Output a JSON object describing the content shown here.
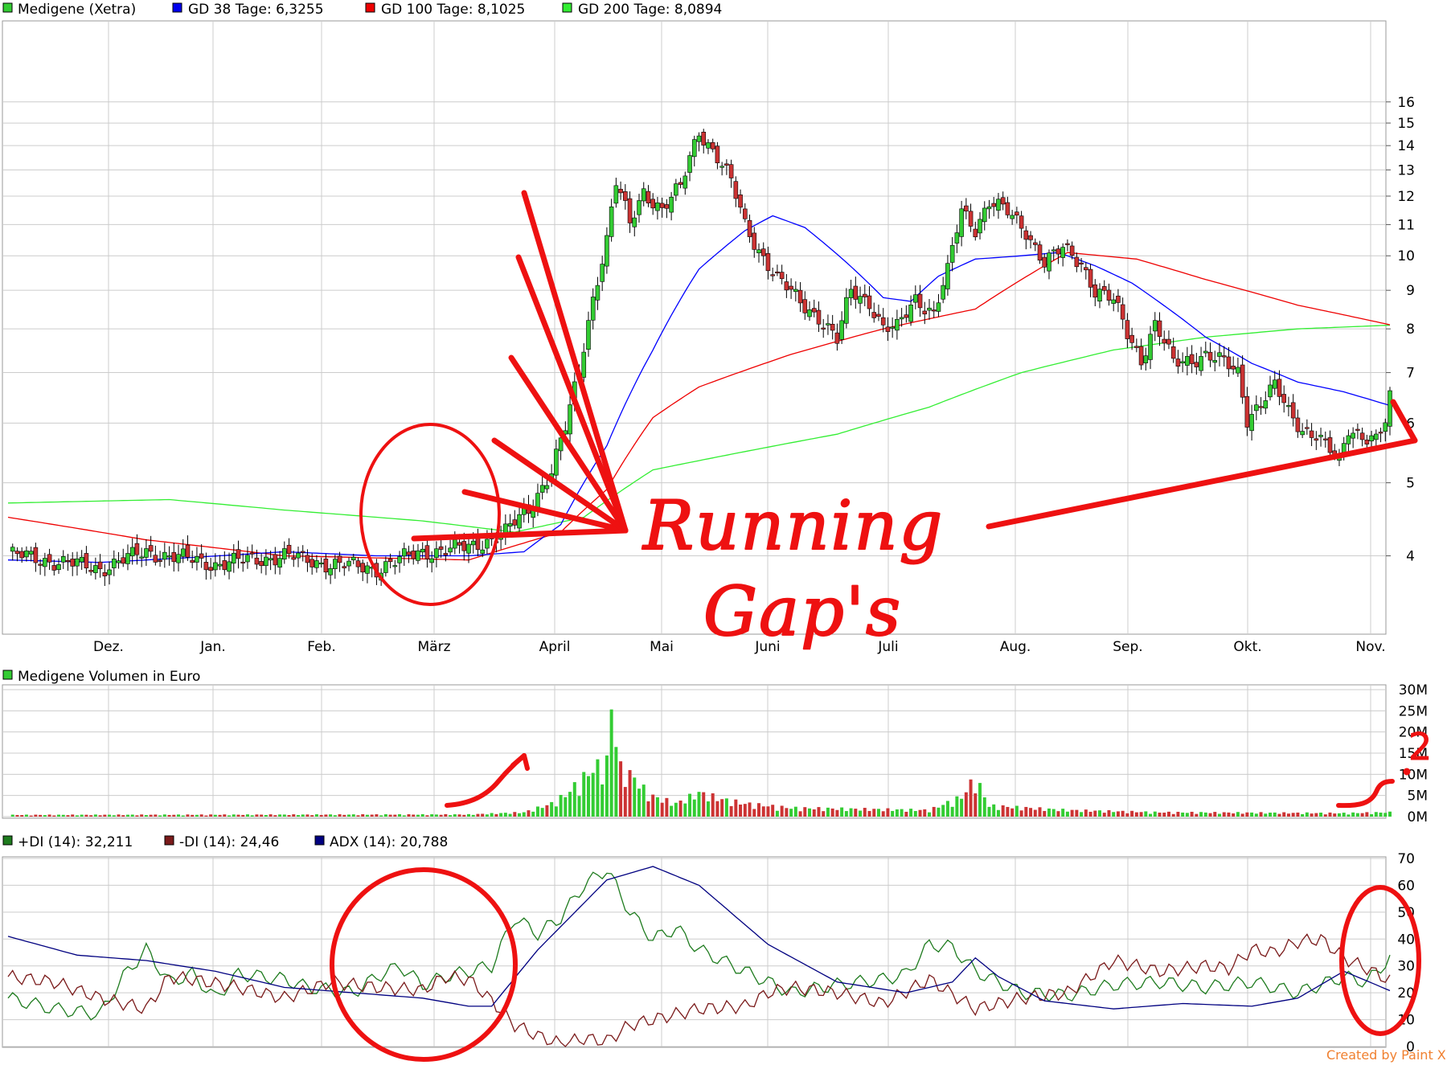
{
  "colors": {
    "up": "#33cc33",
    "down": "#cc3333",
    "gd38": "#0000ff",
    "gd100": "#ee0000",
    "gd200": "#33ee33",
    "pdi": "#1e7b1e",
    "mdi": "#7a1a1a",
    "adx": "#000080",
    "annotation": "#ee1111",
    "grid": "#cccccc"
  },
  "chart_data": [
    {
      "type": "candlestick",
      "log_scale": true,
      "ylim": [
        3.3,
        16.8
      ],
      "y_ticks": [
        "4",
        "5",
        "6",
        "7",
        "8",
        "9",
        "10",
        "11",
        "12",
        "13",
        "14",
        "15",
        "16"
      ],
      "x_ticks": [
        "Dez.",
        "Jan.",
        "Feb.",
        "März",
        "April",
        "Mai",
        "Juni",
        "Juli",
        "Aug.",
        "Sep.",
        "Okt.",
        "Nov."
      ],
      "grid": true,
      "legend": [
        {
          "label": "Medigene (Xetra)",
          "color": "#33cc33"
        },
        {
          "label": "GD 38 Tage: 6,3255",
          "color": "#0000ee"
        },
        {
          "label": "GD 100 Tage: 8,1025",
          "color": "#ee0000"
        },
        {
          "label": "GD 200 Tage: 8,0894",
          "color": "#33ee33"
        }
      ],
      "price_keypoints": [
        [
          0,
          4.02
        ],
        [
          20,
          3.85
        ],
        [
          30,
          4.05
        ],
        [
          45,
          3.9
        ],
        [
          60,
          4.0
        ],
        [
          70,
          3.9
        ],
        [
          80,
          3.85
        ],
        [
          90,
          4.05
        ],
        [
          100,
          4.1
        ],
        [
          108,
          4.3
        ],
        [
          113,
          4.6
        ],
        [
          118,
          5.2
        ],
        [
          121,
          5.9
        ],
        [
          124,
          7.0
        ],
        [
          127,
          8.8
        ],
        [
          130,
          10.5
        ],
        [
          132,
          12.5
        ],
        [
          135,
          11.0
        ],
        [
          138,
          12.2
        ],
        [
          142,
          11.5
        ],
        [
          146,
          12.3
        ],
        [
          150,
          14.7
        ],
        [
          154,
          13.5
        ],
        [
          157,
          12.5
        ],
        [
          160,
          11.0
        ],
        [
          163,
          10.2
        ],
        [
          167,
          9.3
        ],
        [
          172,
          8.7
        ],
        [
          176,
          8.3
        ],
        [
          180,
          7.7
        ],
        [
          183,
          9.0
        ],
        [
          187,
          8.7
        ],
        [
          190,
          8.0
        ],
        [
          193,
          8.0
        ],
        [
          197,
          8.8
        ],
        [
          201,
          8.4
        ],
        [
          204,
          9.5
        ],
        [
          207,
          11.5
        ],
        [
          210,
          10.9
        ],
        [
          213,
          11.8
        ],
        [
          217,
          11.4
        ],
        [
          221,
          10.8
        ],
        [
          225,
          9.8
        ],
        [
          229,
          10.2
        ],
        [
          233,
          9.8
        ],
        [
          236,
          9.0
        ],
        [
          240,
          8.7
        ],
        [
          243,
          7.9
        ],
        [
          246,
          7.3
        ],
        [
          249,
          8.1
        ],
        [
          253,
          7.2
        ],
        [
          257,
          7.3
        ],
        [
          260,
          7.4
        ],
        [
          264,
          7.2
        ],
        [
          267,
          7.0
        ],
        [
          269,
          6.1
        ],
        [
          272,
          6.4
        ],
        [
          275,
          6.7
        ],
        [
          278,
          6.2
        ],
        [
          281,
          5.9
        ],
        [
          284,
          5.8
        ],
        [
          287,
          5.5
        ],
        [
          289,
          5.3
        ],
        [
          291,
          5.9
        ],
        [
          294,
          5.8
        ],
        [
          297,
          5.7
        ],
        [
          299,
          6.0
        ],
        [
          300,
          6.45
        ]
      ],
      "gd38_keypoints": [
        [
          0,
          3.95
        ],
        [
          20,
          3.92
        ],
        [
          40,
          3.98
        ],
        [
          60,
          4.05
        ],
        [
          80,
          4.0
        ],
        [
          100,
          4.0
        ],
        [
          112,
          4.05
        ],
        [
          120,
          4.4
        ],
        [
          130,
          5.6
        ],
        [
          140,
          7.5
        ],
        [
          150,
          9.6
        ],
        [
          160,
          10.8
        ],
        [
          166,
          11.3
        ],
        [
          173,
          10.9
        ],
        [
          182,
          9.8
        ],
        [
          190,
          8.8
        ],
        [
          196,
          8.7
        ],
        [
          202,
          9.4
        ],
        [
          210,
          9.9
        ],
        [
          220,
          10.0
        ],
        [
          228,
          10.1
        ],
        [
          236,
          9.7
        ],
        [
          244,
          9.2
        ],
        [
          252,
          8.5
        ],
        [
          260,
          7.8
        ],
        [
          270,
          7.2
        ],
        [
          280,
          6.8
        ],
        [
          290,
          6.6
        ],
        [
          300,
          6.33
        ]
      ],
      "gd100_keypoints": [
        [
          0,
          4.5
        ],
        [
          30,
          4.2
        ],
        [
          60,
          4.0
        ],
        [
          100,
          3.95
        ],
        [
          120,
          4.3
        ],
        [
          130,
          4.9
        ],
        [
          140,
          6.1
        ],
        [
          150,
          6.7
        ],
        [
          170,
          7.4
        ],
        [
          190,
          8.0
        ],
        [
          210,
          8.5
        ],
        [
          220,
          9.3
        ],
        [
          230,
          10.1
        ],
        [
          245,
          9.9
        ],
        [
          260,
          9.3
        ],
        [
          280,
          8.6
        ],
        [
          300,
          8.1
        ]
      ],
      "gd200_keypoints": [
        [
          0,
          4.7
        ],
        [
          35,
          4.75
        ],
        [
          60,
          4.6
        ],
        [
          90,
          4.45
        ],
        [
          110,
          4.3
        ],
        [
          125,
          4.5
        ],
        [
          140,
          5.2
        ],
        [
          160,
          5.5
        ],
        [
          180,
          5.8
        ],
        [
          200,
          6.3
        ],
        [
          220,
          7.0
        ],
        [
          240,
          7.5
        ],
        [
          260,
          7.8
        ],
        [
          280,
          8.0
        ],
        [
          300,
          8.09
        ]
      ]
    },
    {
      "type": "bar",
      "title": "Medigene Volumen in Euro",
      "ylim": [
        0,
        30
      ],
      "y_ticks": [
        "0M",
        "5M",
        "10M",
        "15M",
        "20M",
        "25M",
        "30M"
      ],
      "grid": true,
      "volume_keypoints": [
        [
          0,
          0.4
        ],
        [
          100,
          0.5
        ],
        [
          112,
          1.0
        ],
        [
          118,
          3.0
        ],
        [
          121,
          5.0
        ],
        [
          124,
          8.0
        ],
        [
          127,
          11.0
        ],
        [
          130,
          12.5
        ],
        [
          131,
          25.5
        ],
        [
          133,
          11.0
        ],
        [
          136,
          9.0
        ],
        [
          139,
          5.0
        ],
        [
          145,
          3.0
        ],
        [
          150,
          5.5
        ],
        [
          155,
          4.0
        ],
        [
          160,
          3.0
        ],
        [
          170,
          2.0
        ],
        [
          200,
          1.5
        ],
        [
          207,
          4.5
        ],
        [
          210,
          9.0
        ],
        [
          213,
          2.5
        ],
        [
          230,
          1.5
        ],
        [
          250,
          1.0
        ],
        [
          290,
          0.8
        ],
        [
          300,
          1.0
        ]
      ]
    },
    {
      "type": "line",
      "ylim": [
        0,
        70
      ],
      "y_ticks": [
        "0",
        "10",
        "20",
        "30",
        "40",
        "50",
        "60",
        "70"
      ],
      "grid": true,
      "series": [
        {
          "name": "+DI (14): 32,211",
          "color": "#1e7b1e",
          "keypoints": [
            [
              0,
              18
            ],
            [
              10,
              14
            ],
            [
              20,
              12
            ],
            [
              25,
              26
            ],
            [
              30,
              36
            ],
            [
              35,
              24
            ],
            [
              40,
              27
            ],
            [
              45,
              18
            ],
            [
              50,
              27
            ],
            [
              60,
              25
            ],
            [
              65,
              22
            ],
            [
              75,
              20
            ],
            [
              80,
              26
            ],
            [
              85,
              30
            ],
            [
              90,
              23
            ],
            [
              95,
              26
            ],
            [
              100,
              28
            ],
            [
              105,
              30
            ],
            [
              110,
              48
            ],
            [
              115,
              42
            ],
            [
              120,
              48
            ],
            [
              125,
              60
            ],
            [
              130,
              66
            ],
            [
              135,
              50
            ],
            [
              140,
              40
            ],
            [
              145,
              44
            ],
            [
              150,
              36
            ],
            [
              160,
              28
            ],
            [
              170,
              20
            ],
            [
              180,
              23
            ],
            [
              190,
              25
            ],
            [
              195,
              27
            ],
            [
              200,
              38
            ],
            [
              205,
              37
            ],
            [
              210,
              28
            ],
            [
              220,
              20
            ],
            [
              230,
              19
            ],
            [
              240,
              23
            ],
            [
              250,
              24
            ],
            [
              260,
              22
            ],
            [
              270,
              24
            ],
            [
              280,
              20
            ],
            [
              290,
              26
            ],
            [
              295,
              24
            ],
            [
              300,
              33
            ]
          ]
        },
        {
          "name": "-DI (14): 24,46",
          "color": "#7a1a1a",
          "keypoints": [
            [
              0,
              26
            ],
            [
              10,
              24
            ],
            [
              20,
              18
            ],
            [
              30,
              14
            ],
            [
              35,
              26
            ],
            [
              40,
              25
            ],
            [
              50,
              22
            ],
            [
              60,
              18
            ],
            [
              70,
              24
            ],
            [
              80,
              22
            ],
            [
              90,
              21
            ],
            [
              95,
              26
            ],
            [
              100,
              25
            ],
            [
              105,
              17
            ],
            [
              110,
              8
            ],
            [
              115,
              4
            ],
            [
              120,
              1
            ],
            [
              125,
              3
            ],
            [
              130,
              2
            ],
            [
              135,
              8
            ],
            [
              145,
              12
            ],
            [
              150,
              14
            ],
            [
              160,
              15
            ],
            [
              165,
              20
            ],
            [
              170,
              22
            ],
            [
              180,
              20
            ],
            [
              190,
              16
            ],
            [
              200,
              25
            ],
            [
              210,
              14
            ],
            [
              220,
              18
            ],
            [
              230,
              20
            ],
            [
              240,
              32
            ],
            [
              250,
              28
            ],
            [
              260,
              30
            ],
            [
              265,
              29
            ],
            [
              270,
              36
            ],
            [
              275,
              35
            ],
            [
              280,
              39
            ],
            [
              285,
              40
            ],
            [
              290,
              33
            ],
            [
              295,
              29
            ],
            [
              300,
              24.5
            ]
          ]
        },
        {
          "name": "ADX (14): 20,788",
          "color": "#000080",
          "keypoints": [
            [
              0,
              41
            ],
            [
              15,
              34
            ],
            [
              30,
              32
            ],
            [
              45,
              28
            ],
            [
              60,
              22
            ],
            [
              75,
              20
            ],
            [
              90,
              18
            ],
            [
              100,
              15
            ],
            [
              105,
              15
            ],
            [
              115,
              36
            ],
            [
              130,
              62
            ],
            [
              140,
              67
            ],
            [
              150,
              60
            ],
            [
              165,
              38
            ],
            [
              180,
              24
            ],
            [
              195,
              20
            ],
            [
              205,
              24
            ],
            [
              210,
              33
            ],
            [
              215,
              26
            ],
            [
              225,
              17
            ],
            [
              240,
              14
            ],
            [
              255,
              16
            ],
            [
              270,
              15
            ],
            [
              280,
              18
            ],
            [
              290,
              28
            ],
            [
              300,
              20.8
            ]
          ]
        }
      ]
    }
  ],
  "annotation": {
    "text_line1": "Running",
    "text_line2": "Gap's",
    "mark_2": "2"
  },
  "watermark": "Created by Paint X"
}
